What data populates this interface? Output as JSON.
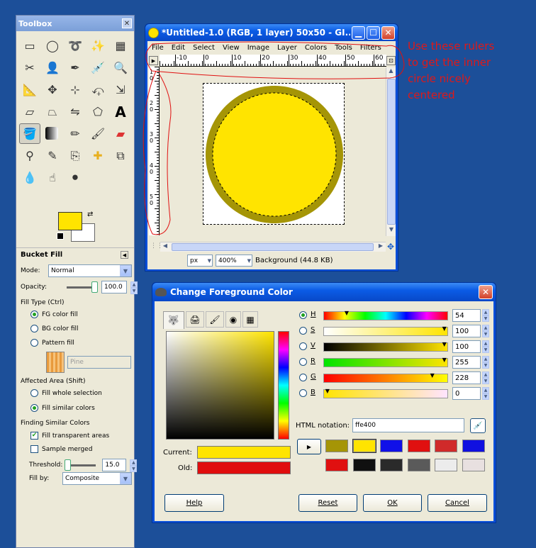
{
  "toolbox": {
    "title": "Toolbox",
    "options_title": "Bucket Fill",
    "mode_label": "Mode:",
    "mode_value": "Normal",
    "opacity_label": "Opacity:",
    "opacity_value": "100.0",
    "fill_type_label": "Fill Type  (Ctrl)",
    "fill_fg": "FG color fill",
    "fill_bg": "BG color fill",
    "fill_pattern": "Pattern fill",
    "pattern_name": "Pine",
    "affected_area_label": "Affected Area  (Shift)",
    "fill_whole": "Fill whole selection",
    "fill_similar": "Fill similar colors",
    "finding_label": "Finding Similar Colors",
    "fill_transparent": "Fill transparent areas",
    "sample_merged": "Sample merged",
    "threshold_label": "Threshold:",
    "threshold_value": "15.0",
    "fill_by_label": "Fill by:",
    "fill_by_value": "Composite",
    "fg_color": "#ffe400",
    "bg_color": "#ffffff"
  },
  "image_window": {
    "title": "*Untitled-1.0 (RGB, 1 layer) 50x50 - GI...",
    "menu": [
      "File",
      "Edit",
      "Select",
      "View",
      "Image",
      "Layer",
      "Colors",
      "Tools",
      "Filters"
    ],
    "ruler_ticks": [
      "-10",
      "0",
      "10",
      "20",
      "30",
      "40",
      "50",
      "60"
    ],
    "vruler_ticks": [
      "1\n0",
      "2\n0",
      "3\n0",
      "4\n0",
      "5\n0"
    ],
    "unit": "px",
    "zoom": "400%",
    "status": "Background (44.8 KB)"
  },
  "annotation": {
    "line1": "Use these rulers",
    "line2": " to get the inner",
    "line3": "circle nicely",
    "line4": "centered"
  },
  "color_dialog": {
    "title": "Change Foreground Color",
    "channels": [
      {
        "key": "h",
        "label": "H",
        "value": "54"
      },
      {
        "key": "s",
        "label": "S",
        "value": "100"
      },
      {
        "key": "v",
        "label": "V",
        "value": "100"
      },
      {
        "key": "r",
        "label": "R",
        "value": "255"
      },
      {
        "key": "g",
        "label": "G",
        "value": "228"
      },
      {
        "key": "b",
        "label": "B",
        "value": "0"
      }
    ],
    "html_label": "HTML notation:",
    "html_value": "ffe400",
    "current_label": "Current:",
    "old_label": "Old:",
    "current_color": "#ffe400",
    "old_color": "#e00d0d",
    "history": [
      "#a59506",
      "#ffe400",
      "#1010e8",
      "#e01010",
      "#d02a2a",
      "#1010e0",
      "#e01010",
      "#101010",
      "#2a2a2a",
      "#5a5a5a",
      "#ececec",
      "#e8e0e0"
    ],
    "help": "Help",
    "reset": "Reset",
    "ok": "OK",
    "cancel": "Cancel"
  }
}
